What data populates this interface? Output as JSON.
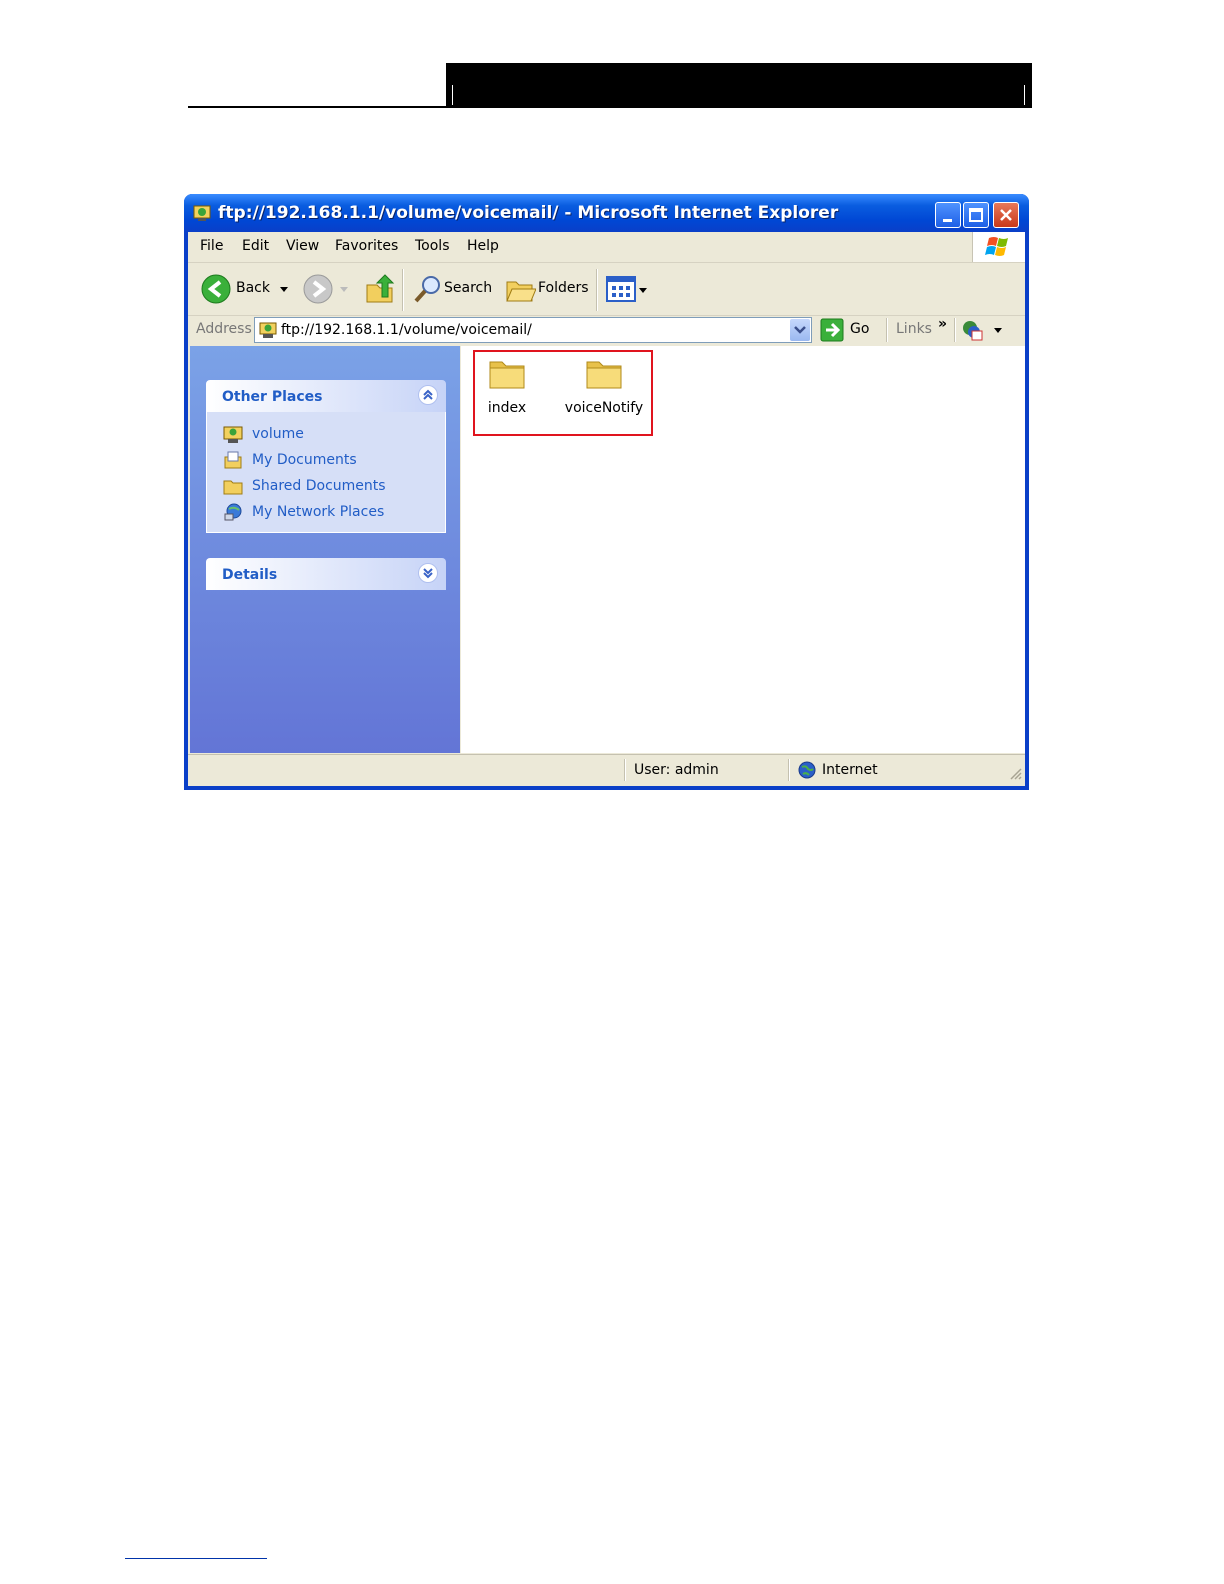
{
  "window": {
    "title": "ftp://192.168.1.1/volume/voicemail/ - Microsoft Internet Explorer"
  },
  "menu": [
    "File",
    "Edit",
    "View",
    "Favorites",
    "Tools",
    "Help"
  ],
  "toolbar": {
    "back_label": "Back",
    "search_label": "Search",
    "folders_label": "Folders"
  },
  "address": {
    "label": "Address",
    "value": "ftp://192.168.1.1/volume/voicemail/",
    "go_label": "Go",
    "links_label": "Links",
    "chevron": "»"
  },
  "sidebar": {
    "other_places": {
      "title": "Other Places",
      "items": [
        {
          "label": "volume",
          "icon": "ftp-folder-icon"
        },
        {
          "label": "My Documents",
          "icon": "my-documents-icon"
        },
        {
          "label": "Shared Documents",
          "icon": "shared-folder-icon"
        },
        {
          "label": "My Network Places",
          "icon": "network-places-icon"
        }
      ]
    },
    "details": {
      "title": "Details"
    }
  },
  "files": [
    {
      "name": "index",
      "icon": "folder-icon"
    },
    {
      "name": "voiceNotify",
      "icon": "folder-icon"
    }
  ],
  "status": {
    "user": "User: admin",
    "zone": "Internet"
  },
  "colors": {
    "title_bar": "#0a5de0",
    "link_blue": "#215dc6",
    "highlight_red": "#e0141e"
  }
}
